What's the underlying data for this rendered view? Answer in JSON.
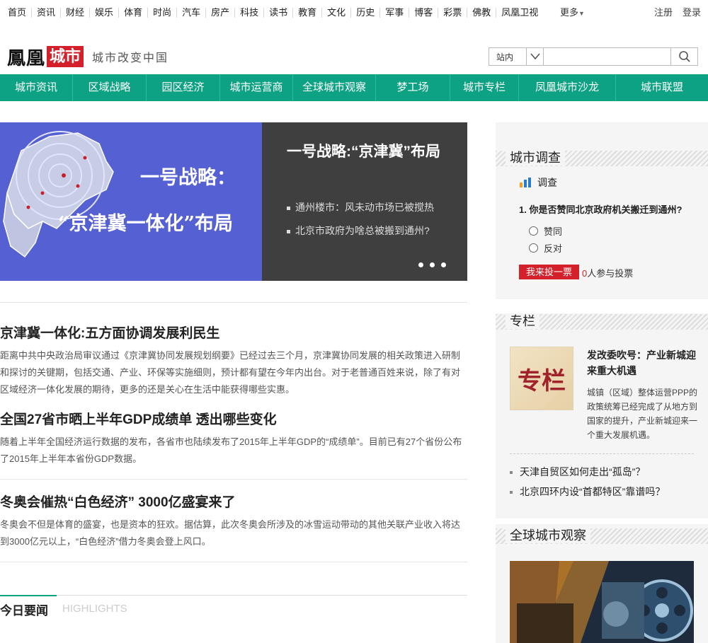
{
  "topnav": {
    "items": [
      "首页",
      "资讯",
      "财经",
      "娱乐",
      "体育",
      "时尚",
      "汽车",
      "房产",
      "科技",
      "读书",
      "教育",
      "文化",
      "历史",
      "军事",
      "博客",
      "彩票",
      "佛教",
      "凤凰卫视"
    ],
    "more": "更多",
    "register": "注册",
    "login": "登录"
  },
  "logo": {
    "brand": "鳳凰",
    "city": "城市",
    "slogan": "城市改变中国"
  },
  "search": {
    "scope": "站内",
    "value": ""
  },
  "mainnav": [
    {
      "label": "城市资讯"
    },
    {
      "label": "区域战略"
    },
    {
      "label": "园区经济"
    },
    {
      "label": "城市运营商"
    },
    {
      "label": "全球城市观察"
    },
    {
      "label": "梦工场"
    },
    {
      "label": "城市专栏"
    },
    {
      "label": "凤凰城市沙龙"
    },
    {
      "label": "城市联盟"
    }
  ],
  "banner": {
    "image_line1": "一号战略：",
    "image_line2": "“京津冀一体化”布局",
    "title": "一号战略:“京津冀”布局",
    "links": [
      "通州楼市：风未动市场已被搅热",
      "北京市政府为啥总被搬到通州?"
    ]
  },
  "news": [
    {
      "title": "京津冀一体化:五方面协调发展利民生",
      "summary": "距离中共中央政治局审议通过《京津冀协同发展规划纲要》已经过去三个月，京津冀协同发展的相关政策进入研制和探讨的关键期，包括交通、产业、环保等实施细则，预计都有望在今年内出台。对于老普通百姓来说，除了有对区域经济一体化发展的期待，更多的还是关心在生活中能获得哪些实惠。"
    },
    {
      "title": "全国27省市晒上半年GDP成绩单 透出哪些变化",
      "summary": "随着上半年全国经济运行数据的发布，各省市也陆续发布了2015年上半年GDP的“成绩单”。目前已有27个省份公布了2015年上半年本省份GDP数据。"
    },
    {
      "title": "冬奥会催热“白色经济” 3000亿盛宴来了",
      "summary": "冬奥会不但是体育的盛宴，也是资本的狂欢。据估算，此次冬奥会所涉及的冰雪运动带动的其他关联产业收入将达到3000亿元以上，“白色经济”借力冬奥会登上风口。"
    }
  ],
  "highlights": {
    "title": "今日要闻",
    "sub": "HIGHLIGHTS"
  },
  "survey": {
    "section": "城市调查",
    "tag": "调查",
    "question": "1. 你是否赞同北京政府机关搬迁到通州?",
    "options": [
      "赞同",
      "反对"
    ],
    "vote_button": "我来投一票",
    "count": "0",
    "count_suffix": "人参与投票"
  },
  "column": {
    "section": "专栏",
    "image_text": "专栏",
    "title": "发改委吹号：产业新城迎来重大机遇",
    "summary": "城镇（区域）整体运营PPP的政策统筹已经完成了从地方到国家的提升，产业新城迎来一个重大发展机遇。",
    "links": [
      "天津自贸区如何走出“孤岛”？",
      "北京四环内设“首都特区”靠谱吗？"
    ]
  },
  "global": {
    "section": "全球城市观察"
  },
  "colors": {
    "accent": "#0da283",
    "red": "#d3202a",
    "banner_blue": "#5560d2"
  }
}
